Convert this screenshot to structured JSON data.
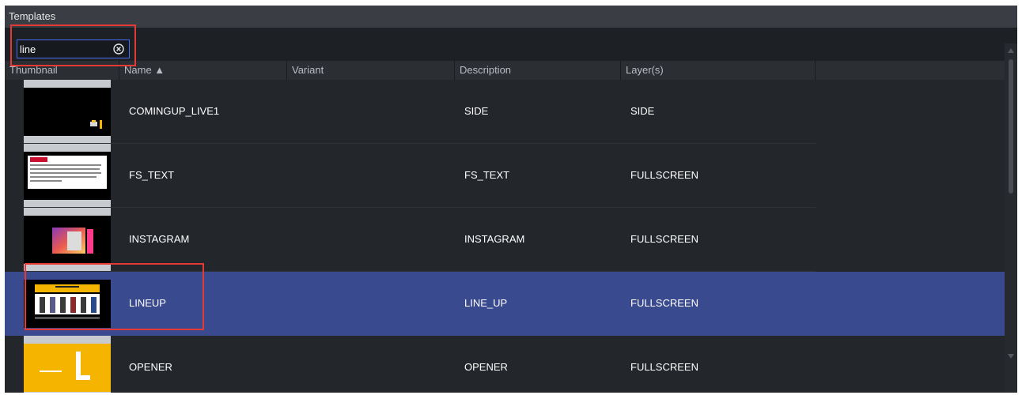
{
  "panel": {
    "title": "Templates"
  },
  "search": {
    "value": "line"
  },
  "columns": {
    "thumbnail": "Thumbnail",
    "name": "Name ▲",
    "variant": "Variant",
    "description": "Description",
    "layers": "Layer(s)"
  },
  "rows": [
    {
      "name": "COMINGUP_LIVE1",
      "variant": "",
      "description": "SIDE",
      "layers": "SIDE"
    },
    {
      "name": "FS_TEXT",
      "variant": "",
      "description": "FS_TEXT",
      "layers": "FULLSCREEN"
    },
    {
      "name": "INSTAGRAM",
      "variant": "",
      "description": "INSTAGRAM",
      "layers": "FULLSCREEN"
    },
    {
      "name": "LINEUP",
      "variant": "",
      "description": "LINE_UP",
      "layers": "FULLSCREEN",
      "selected": true
    },
    {
      "name": "OPENER",
      "variant": "",
      "description": "OPENER",
      "layers": "FULLSCREEN"
    }
  ],
  "thumbnails": {
    "opener_letter": "L"
  },
  "colors": {
    "selection": "#3a4a8f",
    "highlight": "#e53935",
    "search_border": "#4a6df0",
    "opener_bg": "#f5b400"
  }
}
